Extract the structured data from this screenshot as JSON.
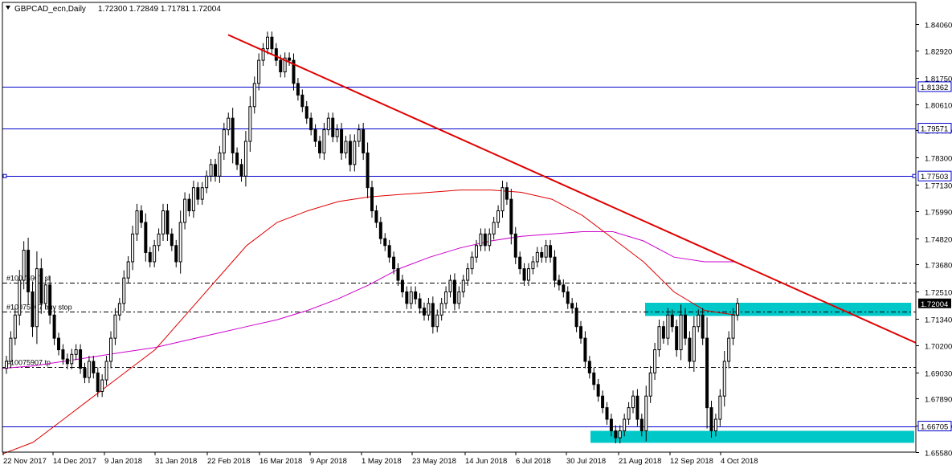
{
  "header": {
    "symbol_label": "GBPCAD_ecn,Daily",
    "ohlc_text": "1.72300 1.72849 1.71781 1.72004"
  },
  "colors": {
    "background": "#ffffff",
    "bull_candle": "#ffffff",
    "bear_candle": "#000000",
    "candle_outline": "#000000",
    "horizontal_lines": "#0000cc",
    "trendline": "#e00000",
    "ma_fast": "#e00000",
    "ma_slow": "#cc00cc",
    "zones": "#00c8c8",
    "dash_lines": "#000000",
    "axis_text": "#000000"
  },
  "chart_data": {
    "type": "candlestick",
    "ylim": [
      1.6558,
      1.85
    ],
    "y_ticks": [
      "1.84060",
      "1.82920",
      "1.81750",
      "1.80610",
      "1.79470",
      "1.78300",
      "1.77130",
      "1.75990",
      "1.74820",
      "1.73680",
      "1.72510",
      "1.71340",
      "1.70200",
      "1.69030",
      "1.67890",
      "1.66720",
      "1.65580"
    ],
    "x_ticks": [
      "22 Nov 2017",
      "14 Dec 2017",
      "9 Jan 2018",
      "31 Jan 2018",
      "22 Feb 2018",
      "16 Mar 2018",
      "9 Apr 2018",
      "1 May 2018",
      "23 May 2018",
      "14 Jun 2018",
      "6 Jul 2018",
      "30 Jul 2018",
      "21 Aug 2018",
      "12 Sep 2018",
      "4 Oct 2018"
    ],
    "price_lines": [
      {
        "value": 1.81362,
        "label": "1.81362"
      },
      {
        "value": 1.79571,
        "label": "1.79571"
      },
      {
        "value": 1.77503,
        "label": "1.77503"
      },
      {
        "value": 1.66705,
        "label": "1.66705"
      }
    ],
    "current_price": {
      "value": 1.72004,
      "label": "1.72004"
    },
    "order_lines": [
      {
        "value": 1.729,
        "label": "#10075907 sl"
      },
      {
        "value": 1.7165,
        "label": "#10075907 buy stop"
      },
      {
        "value": 1.6925,
        "label": "#10075907 tp"
      }
    ],
    "zones": [
      {
        "from": 1.7146,
        "to": 1.7203
      },
      {
        "from": 1.6598,
        "to": 1.665
      }
    ],
    "trendline": {
      "from": [
        "22 Feb 2018",
        1.836
      ],
      "to": [
        "end",
        1.703
      ]
    },
    "close_series": [
      1.695,
      1.705,
      1.715,
      1.73,
      1.743,
      1.725,
      1.71,
      1.735,
      1.72,
      1.728,
      1.715,
      1.705,
      1.7,
      1.696,
      1.694,
      1.698,
      1.7,
      1.692,
      1.688,
      1.695,
      1.69,
      1.682,
      1.687,
      1.695,
      1.705,
      1.715,
      1.72,
      1.731,
      1.738,
      1.75,
      1.76,
      1.755,
      1.742,
      1.738,
      1.745,
      1.75,
      1.76,
      1.75,
      1.745,
      1.738,
      1.755,
      1.765,
      1.76,
      1.77,
      1.765,
      1.77,
      1.775,
      1.78,
      1.775,
      1.785,
      1.795,
      1.8,
      1.785,
      1.78,
      1.775,
      1.79,
      1.805,
      1.815,
      1.825,
      1.83,
      1.835,
      1.83,
      1.825,
      1.82,
      1.826,
      1.825,
      1.815,
      1.81,
      1.805,
      1.8,
      1.795,
      1.79,
      1.785,
      1.795,
      1.8,
      1.792,
      1.795,
      1.785,
      1.79,
      1.78,
      1.79,
      1.795,
      1.785,
      1.77,
      1.76,
      1.755,
      1.748,
      1.745,
      1.74,
      1.735,
      1.73,
      1.725,
      1.72,
      1.725,
      1.722,
      1.718,
      1.715,
      1.72,
      1.71,
      1.715,
      1.72,
      1.725,
      1.73,
      1.72,
      1.725,
      1.73,
      1.735,
      1.74,
      1.745,
      1.75,
      1.745,
      1.75,
      1.755,
      1.76,
      1.77,
      1.765,
      1.75,
      1.74,
      1.735,
      1.73,
      1.735,
      1.738,
      1.742,
      1.74,
      1.745,
      1.74,
      1.73,
      1.728,
      1.725,
      1.72,
      1.718,
      1.71,
      1.705,
      1.695,
      1.69,
      1.685,
      1.68,
      1.675,
      1.67,
      1.665,
      1.662,
      1.665,
      1.67,
      1.675,
      1.68,
      1.67,
      1.665,
      1.68,
      1.69,
      1.7,
      1.71,
      1.705,
      1.715,
      1.71,
      1.7,
      1.715,
      1.705,
      1.695,
      1.71,
      1.715,
      1.705,
      1.675,
      1.665,
      1.67,
      1.68,
      1.695,
      1.705,
      1.715,
      1.72
    ],
    "ma_fast_series": [
      1.655,
      1.66,
      1.67,
      1.68,
      1.69,
      1.7,
      1.715,
      1.73,
      1.745,
      1.755,
      1.76,
      1.764,
      1.766,
      1.767,
      1.768,
      1.769,
      1.769,
      1.768,
      1.765,
      1.758,
      1.748,
      1.738,
      1.725,
      1.717,
      1.715
    ],
    "ma_slow_series": [
      1.692,
      1.693,
      1.695,
      1.697,
      1.699,
      1.701,
      1.704,
      1.707,
      1.71,
      1.713,
      1.717,
      1.722,
      1.728,
      1.735,
      1.74,
      1.744,
      1.747,
      1.749,
      1.75,
      1.751,
      1.751,
      1.747,
      1.74,
      1.738,
      1.738
    ]
  }
}
